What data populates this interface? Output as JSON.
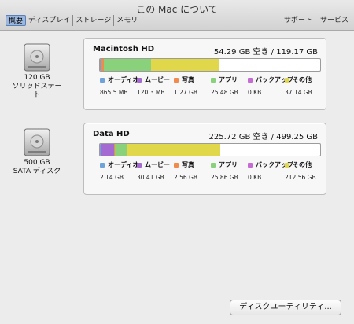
{
  "window": {
    "title": "この Mac について"
  },
  "tabs": [
    "概要",
    "ディスプレイ",
    "ストレージ",
    "メモリ"
  ],
  "right_links": [
    "サポート",
    "サービス"
  ],
  "drives": [
    {
      "icon": "hard-drive-icon",
      "caption_line1": "120 GB",
      "caption_line2": "ソリッドステート",
      "volume": "Macintosh HD",
      "space": "54.29 GB 空き / 119.17 GB",
      "usage": [
        {
          "name": "オーディオ",
          "value": "865.5 MB",
          "color": "#6ea3d9",
          "fraction": 0.0073
        },
        {
          "name": "ムービー",
          "value": "120.3 MB",
          "color": "#a46ad1",
          "fraction": 0.001
        },
        {
          "name": "写真",
          "value": "1.27 GB",
          "color": "#f08b4c",
          "fraction": 0.0107
        },
        {
          "name": "アプリ",
          "value": "25.48 GB",
          "color": "#8ad17c",
          "fraction": 0.2138
        },
        {
          "name": "バックアップ",
          "value": "0 KB",
          "color": "#c66bd3",
          "fraction": 0.0
        },
        {
          "name": "その他",
          "value": "37.14 GB",
          "color": "#e0d84a",
          "fraction": 0.3117
        }
      ]
    },
    {
      "icon": "hard-drive-icon",
      "caption_line1": "500 GB",
      "caption_line2": "SATA ディスク",
      "volume": "Data HD",
      "space": "225.72 GB 空き / 499.25 GB",
      "usage": [
        {
          "name": "オーディオ",
          "value": "2.14 GB",
          "color": "#6ea3d9",
          "fraction": 0.0043
        },
        {
          "name": "ムービー",
          "value": "30.41 GB",
          "color": "#a46ad1",
          "fraction": 0.0609
        },
        {
          "name": "写真",
          "value": "2.56 GB",
          "color": "#f08b4c",
          "fraction": 0.0051
        },
        {
          "name": "アプリ",
          "value": "25.86 GB",
          "color": "#8ad17c",
          "fraction": 0.0518
        },
        {
          "name": "バックアップ",
          "value": "0 KB",
          "color": "#c66bd3",
          "fraction": 0.0
        },
        {
          "name": "その他",
          "value": "212.56 GB",
          "color": "#e0d84a",
          "fraction": 0.4258
        }
      ]
    }
  ],
  "footer": {
    "button": "ディスクユーティリティ..."
  }
}
